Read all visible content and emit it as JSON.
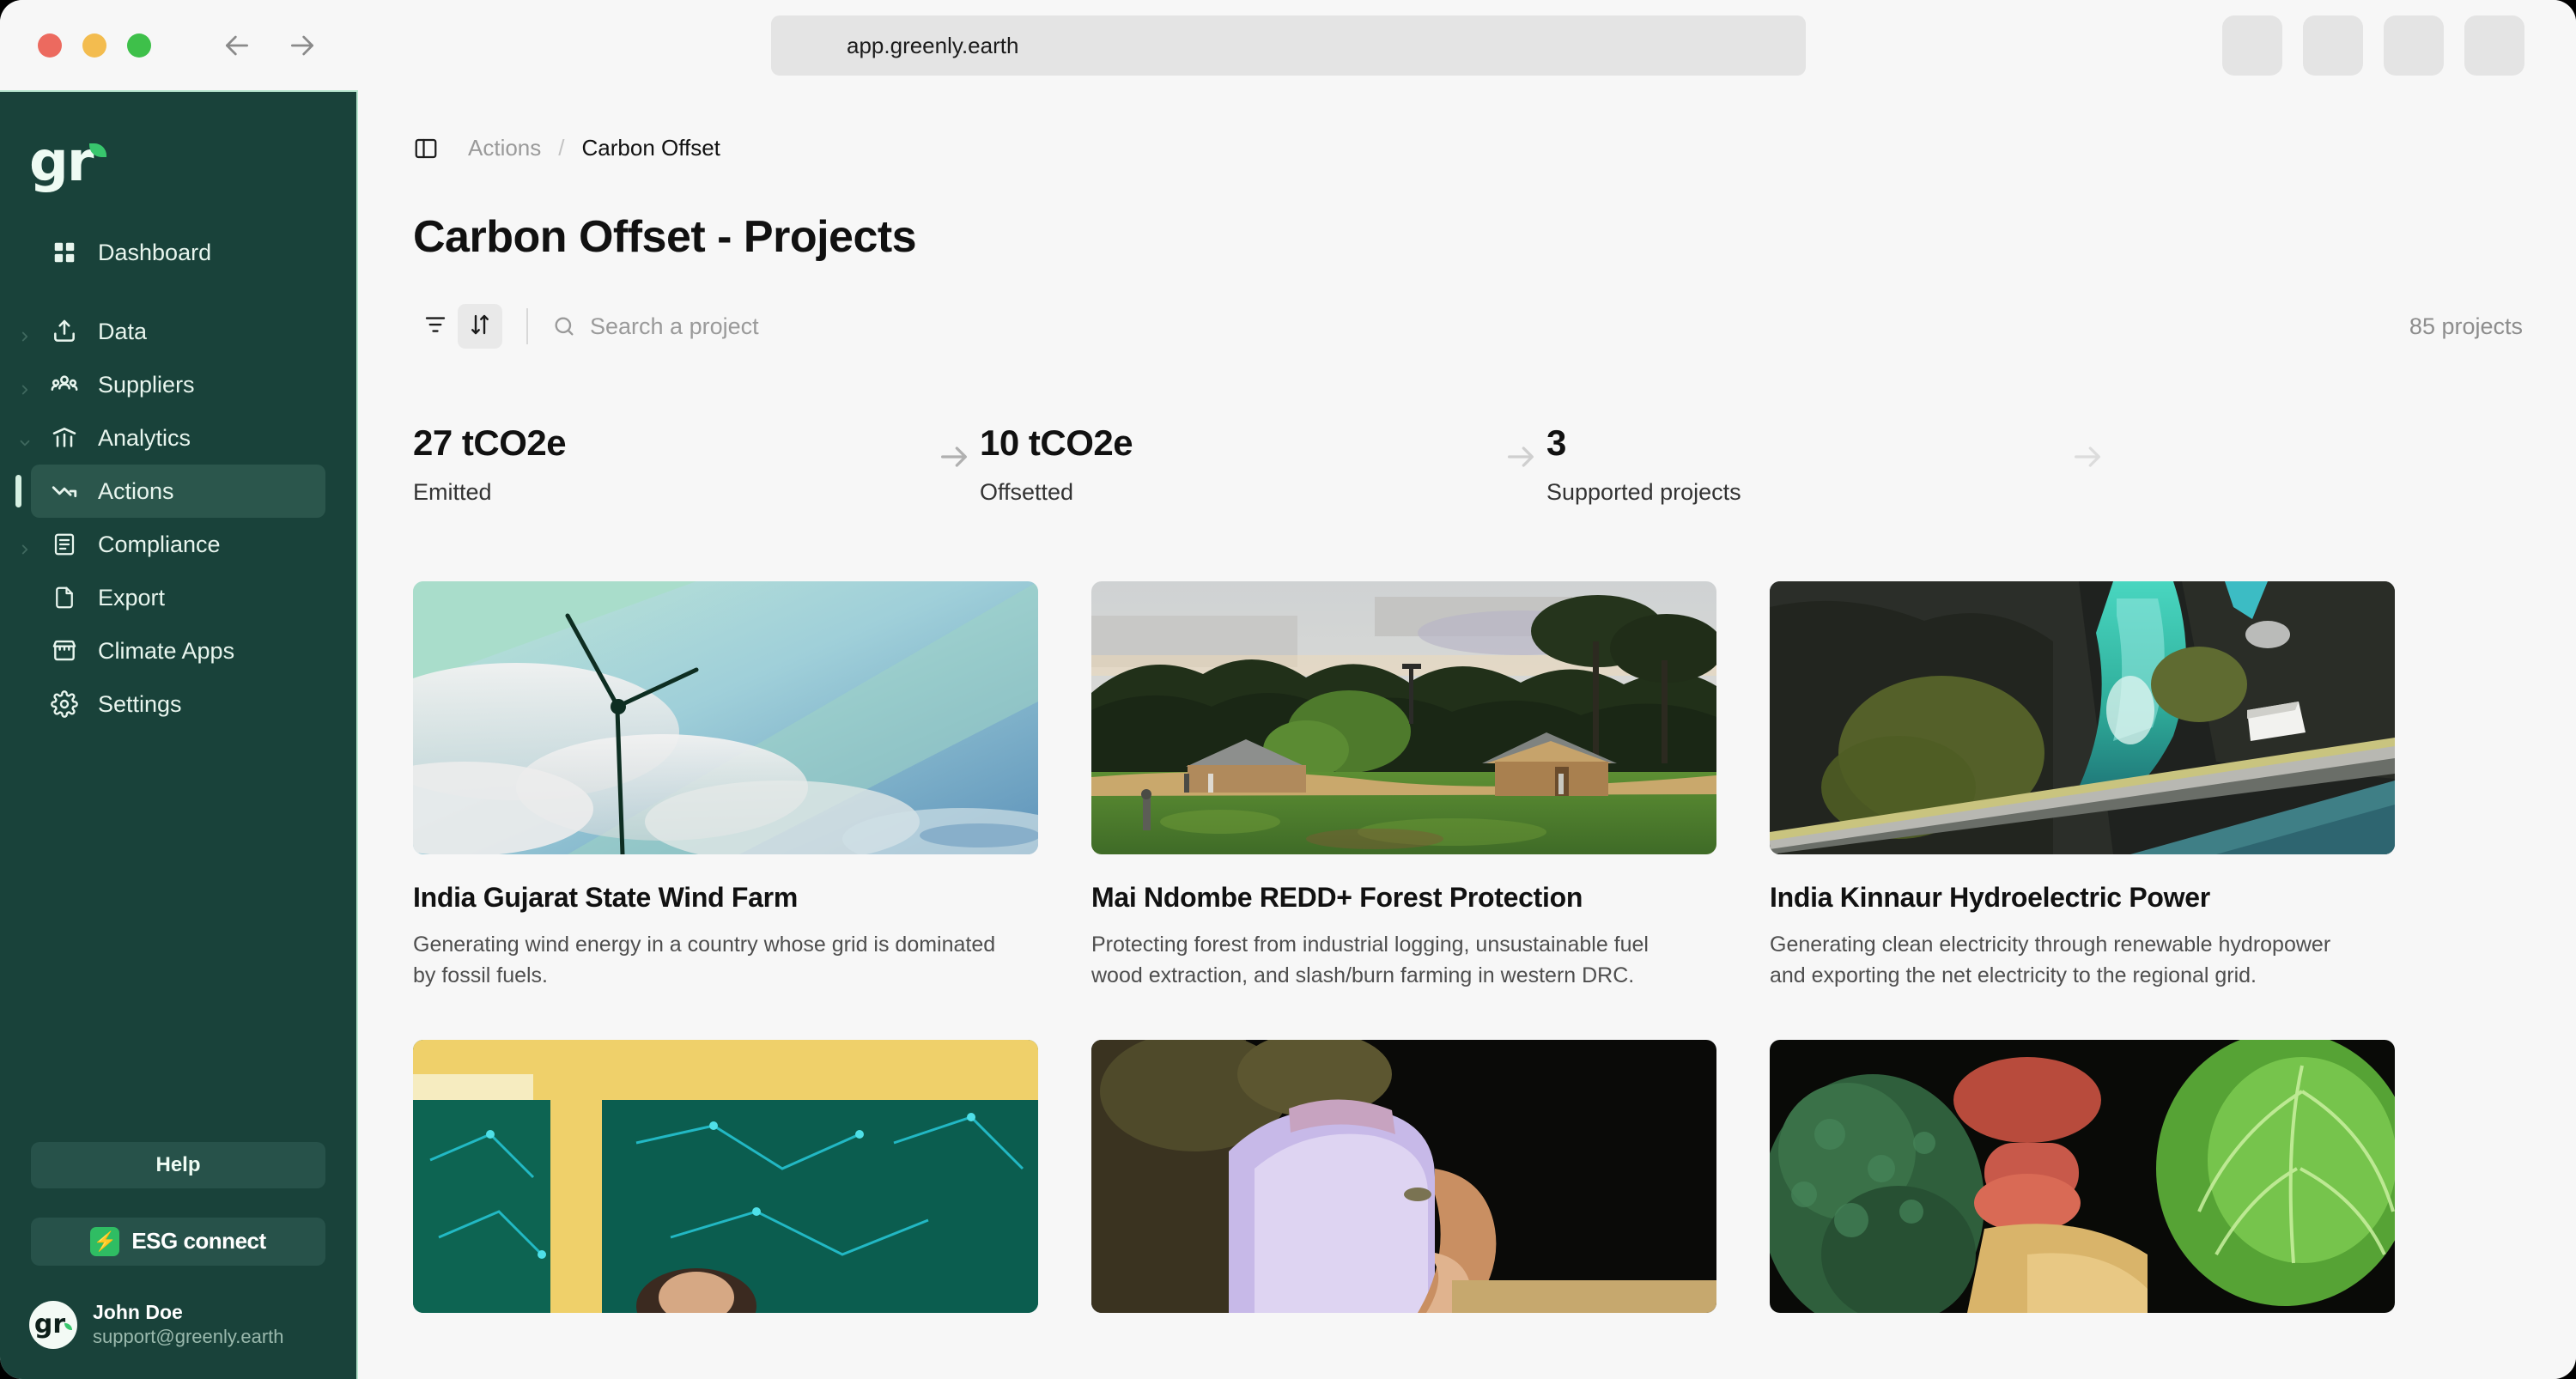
{
  "browser": {
    "url": "app.greenly.earth",
    "back_icon": "arrow-left-icon",
    "forward_icon": "arrow-right-icon",
    "traffic_lights": [
      "close",
      "minimize",
      "maximize"
    ],
    "extension_buttons": 4
  },
  "sidebar": {
    "logo_text": "gr",
    "items": [
      {
        "label": "Dashboard",
        "icon": "grid-icon",
        "active": false,
        "expandable": false
      },
      {
        "label": "Data",
        "icon": "upload-icon",
        "active": false,
        "expandable": true
      },
      {
        "label": "Suppliers",
        "icon": "people-icon",
        "active": false,
        "expandable": true
      },
      {
        "label": "Analytics",
        "icon": "bar-chart-icon",
        "active": false,
        "expandable": true
      },
      {
        "label": "Actions",
        "icon": "trend-down-icon",
        "active": true,
        "expandable": false
      },
      {
        "label": "Compliance",
        "icon": "document-lines-icon",
        "active": false,
        "expandable": true
      },
      {
        "label": "Export",
        "icon": "file-icon",
        "active": false,
        "expandable": false
      },
      {
        "label": "Climate Apps",
        "icon": "store-icon",
        "active": false,
        "expandable": false
      },
      {
        "label": "Settings",
        "icon": "gear-icon",
        "active": false,
        "expandable": false
      }
    ],
    "help_label": "Help",
    "esg_label": "ESG connect",
    "esg_icon": "lightning-bolt-icon",
    "user": {
      "name": "John Doe",
      "email": "support@greenly.earth",
      "avatar_text": "gr"
    }
  },
  "header": {
    "panel_toggle_icon": "panel-left-icon",
    "breadcrumb": [
      "Actions",
      "Carbon Offset"
    ],
    "breadcrumb_separator": "/"
  },
  "page": {
    "title": "Carbon Offset - Projects"
  },
  "toolbar": {
    "filter_icon": "filter-icon",
    "sort_icon": "sort-arrows-icon",
    "search_icon": "search-icon",
    "search_placeholder": "Search a project",
    "search_value": "",
    "project_count": "85 projects"
  },
  "stats": [
    {
      "value": "27 tCO2e",
      "label": "Emitted"
    },
    {
      "value": "10 tCO2e",
      "label": "Offsetted"
    },
    {
      "value": "3",
      "label": "Supported projects"
    }
  ],
  "stat_arrow_icon": "arrow-right-icon",
  "projects": [
    {
      "title": "India Gujarat State Wind Farm",
      "description": "Generating wind energy in a country whose grid is dominated by fossil fuels.",
      "image": "wind-turbine-photo"
    },
    {
      "title": "Mai Ndombe REDD+ Forest Protection",
      "description": "Protecting forest from industrial logging, unsustainable fuel wood extraction, and slash/burn farming in western DRC.",
      "image": "forest-village-photo"
    },
    {
      "title": "India Kinnaur Hydroelectric Power",
      "description": "Generating clean electricity through renewable hydropower and exporting the net electricity to the regional grid.",
      "image": "river-hydropower-photo"
    },
    {
      "title": "",
      "description": "",
      "image": "solar-panel-window-photo"
    },
    {
      "title": "",
      "description": "",
      "image": "gloved-hand-photo"
    },
    {
      "title": "",
      "description": "",
      "image": "vegetables-photo"
    }
  ],
  "colors": {
    "sidebar_bg": "#19423a",
    "sidebar_border": "#b8e6cf",
    "sidebar_active": "#2b564c",
    "accent_green": "#38c66d",
    "page_bg": "#f7f7f7",
    "text_primary": "#111111",
    "text_muted": "#8d8d8d"
  }
}
